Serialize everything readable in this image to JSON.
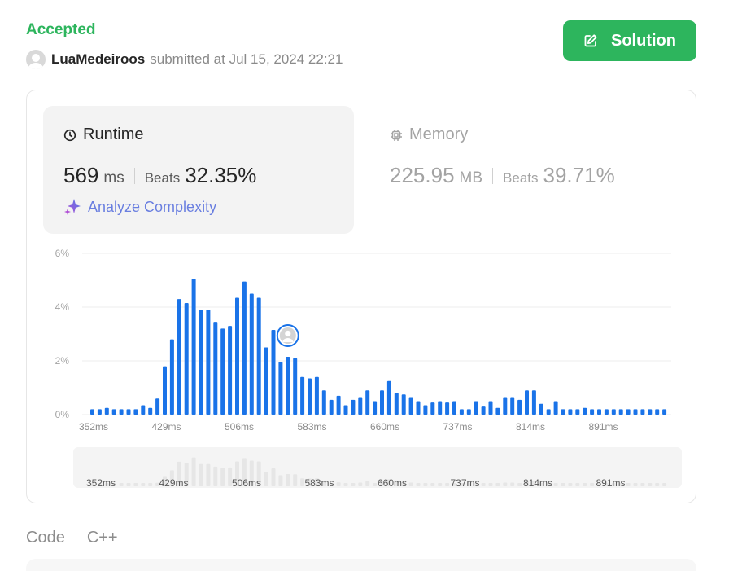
{
  "status": "Accepted",
  "submission": {
    "username": "LuaMedeiroos",
    "submitted_text": "submitted at Jul 15, 2024 22:21"
  },
  "solution_button": "Solution",
  "runtime": {
    "label": "Runtime",
    "value": "569",
    "unit": "ms",
    "beats_label": "Beats",
    "beats_value": "32.35%",
    "analyze_label": "Analyze Complexity"
  },
  "memory": {
    "label": "Memory",
    "value": "225.95",
    "unit": "MB",
    "beats_label": "Beats",
    "beats_value": "39.71%"
  },
  "colors": {
    "accent_green": "#2db55d",
    "bar_blue": "#1a73e8",
    "bar_gray": "#e6e6e6"
  },
  "chart_data": {
    "type": "bar",
    "ylim": [
      0,
      6
    ],
    "y_ticks": [
      "0%",
      "2%",
      "4%",
      "6%"
    ],
    "x_tick_labels": [
      "352ms",
      "429ms",
      "506ms",
      "583ms",
      "660ms",
      "737ms",
      "814ms",
      "891ms"
    ],
    "highlight_index": 27,
    "values": [
      0.2,
      0.2,
      0.25,
      0.2,
      0.2,
      0.2,
      0.2,
      0.35,
      0.25,
      0.6,
      1.8,
      2.8,
      4.3,
      4.15,
      5.05,
      3.9,
      3.9,
      3.45,
      3.2,
      3.3,
      4.35,
      4.95,
      4.5,
      4.35,
      2.5,
      3.15,
      1.95,
      2.15,
      2.1,
      1.4,
      1.35,
      1.4,
      0.9,
      0.55,
      0.7,
      0.35,
      0.55,
      0.65,
      0.9,
      0.5,
      0.9,
      1.25,
      0.8,
      0.75,
      0.65,
      0.5,
      0.35,
      0.45,
      0.5,
      0.45,
      0.5,
      0.2,
      0.2,
      0.5,
      0.3,
      0.5,
      0.25,
      0.65,
      0.65,
      0.55,
      0.9,
      0.9,
      0.4,
      0.2,
      0.5,
      0.2,
      0.2,
      0.2,
      0.25,
      0.2,
      0.2,
      0.2,
      0.2,
      0.2,
      0.2,
      0.2,
      0.2,
      0.2,
      0.2,
      0.2
    ]
  },
  "code_section": {
    "label": "Code",
    "language": "C++"
  }
}
